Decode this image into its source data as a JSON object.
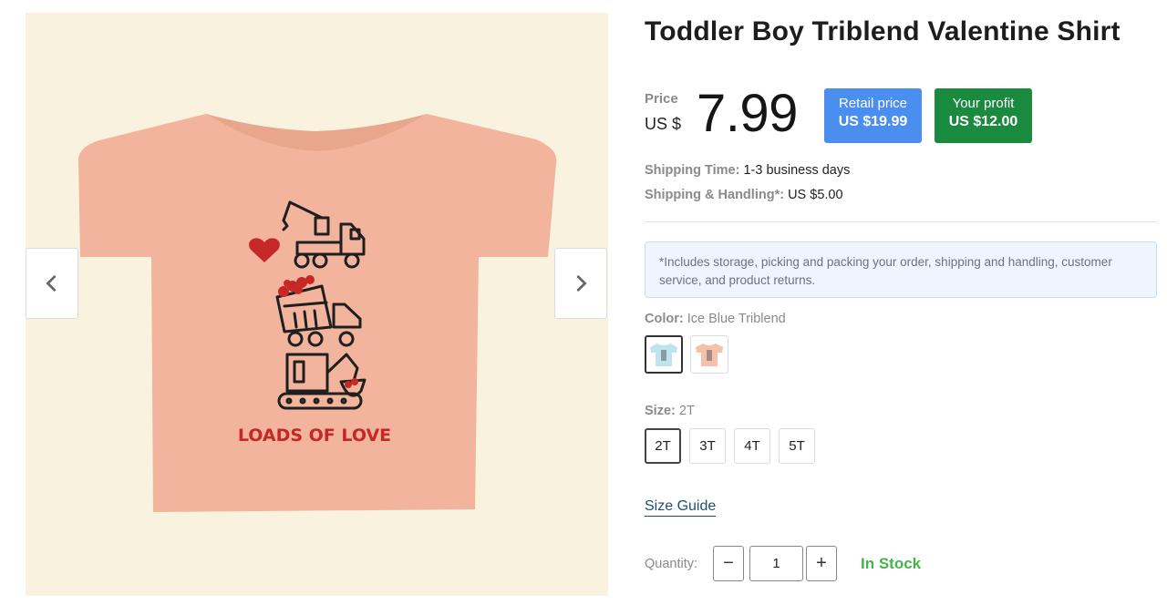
{
  "product": {
    "title": "Toddler Boy Triblend Valentine Shirt",
    "shirt_print_text": "LOADS OF LOVE"
  },
  "gallery": {
    "prev_icon": "chevron-left-icon",
    "next_icon": "chevron-right-icon"
  },
  "price": {
    "label": "Price",
    "currency": "US $",
    "amount": "7.99"
  },
  "badges": {
    "retail_label": "Retail price",
    "retail_value": "US $19.99",
    "profit_label": "Your profit",
    "profit_value": "US $12.00"
  },
  "shipping": {
    "time_label": "Shipping Time:",
    "time_value": "1-3 business days",
    "handling_label": "Shipping & Handling*:",
    "handling_value": "US $5.00"
  },
  "notice": "*Includes storage, picking and packing your order, shipping and handling, customer service, and product returns.",
  "color": {
    "label": "Color:",
    "selected": "Ice Blue Triblend",
    "swatches": [
      "#bfe4ec",
      "#f4c2aa"
    ]
  },
  "size": {
    "label": "Size:",
    "selected": "2T",
    "options": [
      "2T",
      "3T",
      "4T",
      "5T"
    ]
  },
  "size_guide": "Size Guide",
  "quantity": {
    "label": "Quantity:",
    "value": "1",
    "minus": "−",
    "plus": "+"
  },
  "stock_status": "In Stock",
  "colors": {
    "retail_badge": "#4a8ef0",
    "profit_badge": "#1a8a3f",
    "in_stock": "#46b34a",
    "shirt": "#f2b49c",
    "print_red": "#c62828"
  }
}
